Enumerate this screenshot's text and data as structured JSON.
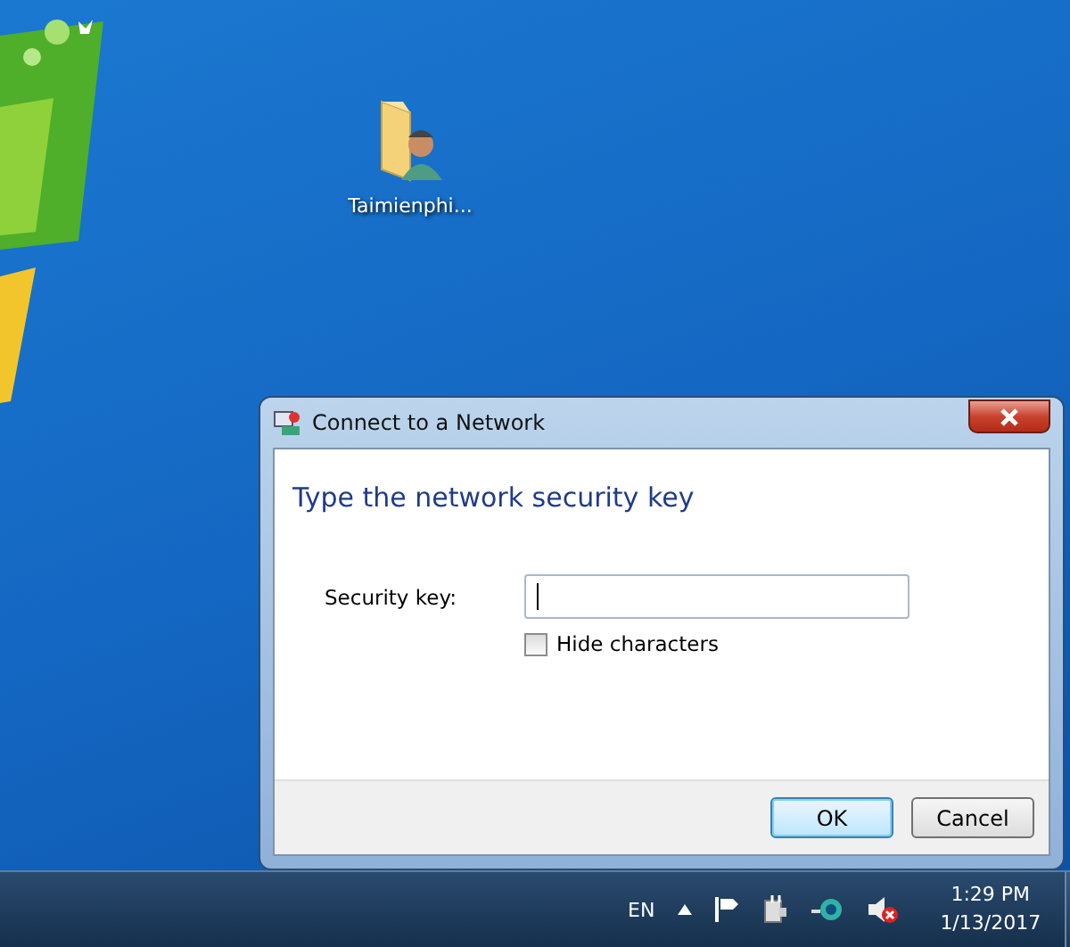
{
  "desktop": {
    "icons": [
      {
        "label": "Taimienphi..."
      }
    ]
  },
  "dialog": {
    "title": "Connect to a Network",
    "heading": "Type the network security key",
    "field": {
      "label": "Security key:"
    },
    "hide_characters": {
      "label": "Hide characters",
      "checked": false
    },
    "buttons": [
      {
        "label": "OK",
        "default": true
      },
      {
        "label": "Cancel",
        "default": false
      }
    ]
  },
  "taskbar": {
    "language": "EN",
    "clock": {
      "time": "1:29 PM",
      "date": "1/13/2017"
    }
  }
}
